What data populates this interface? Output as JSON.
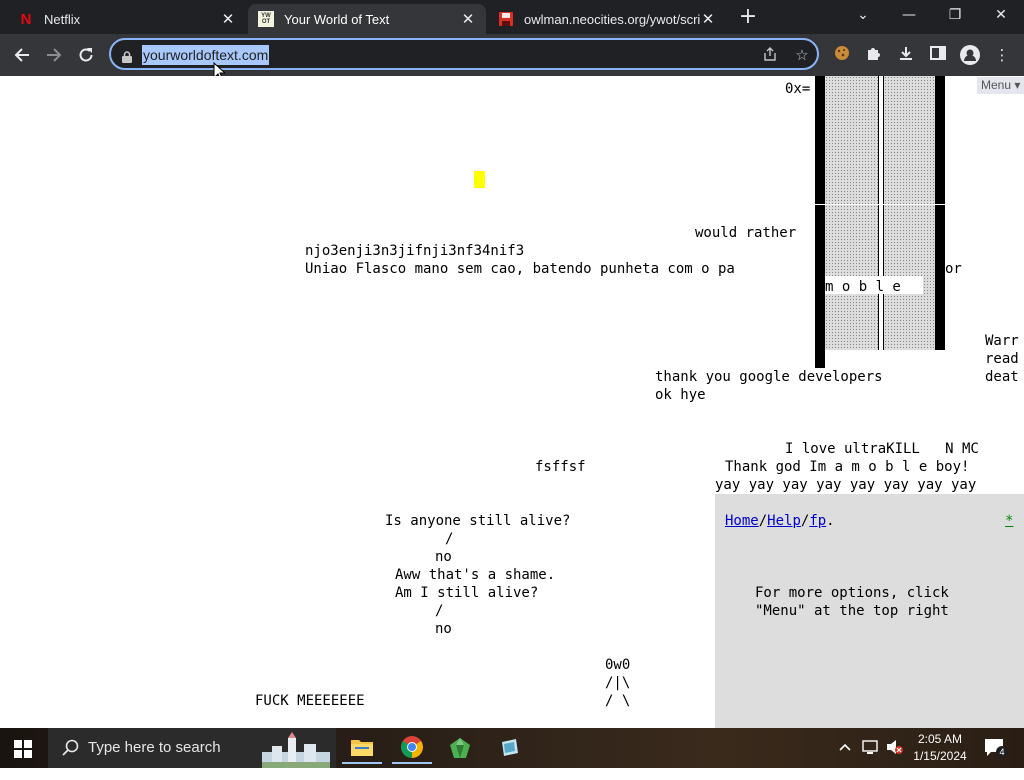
{
  "tabs": [
    {
      "title": "Netflix",
      "favicon": "netflix-n-icon",
      "favicon_color": "#e50914"
    },
    {
      "title": "Your World of Text",
      "favicon": "ywot-favicon-icon",
      "favicon_text": "YW\nOT"
    },
    {
      "title": "owlman.neocities.org/ywot/scrip",
      "favicon": "floppy-disk-icon",
      "favicon_color": "#d93025"
    }
  ],
  "new_tab_label": "+",
  "window_controls": {
    "tab_search": "⌄",
    "minimize": "—",
    "restore": "❐",
    "close": "✕"
  },
  "omnibox": {
    "url": "yourworldoftext.com"
  },
  "page": {
    "menu_label": "Menu ▾",
    "header_coord": "0x=",
    "texts": {
      "would_rather": "would rather",
      "njo": "njo3enji3n3jifnji3nf34nif3",
      "uniao": "Uniao Flasco mano sem cao, batendo punheta com o pa",
      "uniao_tail": "or",
      "moble": "m o b l e",
      "warr": "Warr",
      "read": "read",
      "deat": "deat",
      "thank_google": "thank you google developers",
      "ok_hye": "ok hye",
      "ultrakill": "I love ultraKILL   N MC",
      "fsffsf": "fsffsf",
      "thank_god": "Thank god Im a m o b l e boy!",
      "yay": "yay yay yay yay yay yay yay yay",
      "anyone_alive": "Is anyone still alive?",
      "slash1": "/",
      "no1": "no",
      "aww": "Aww that's a shame.",
      "am_i": "Am I still alive?",
      "slash2": "/",
      "no2": "no",
      "owo": "0w0",
      "owo_arms": "/|\\",
      "owo_legs": "/ \\",
      "fuck": "FUCK MEEEEEEE"
    },
    "panel": {
      "home": "Home",
      "help": "Help",
      "fp": "fp",
      "sep": "/",
      "dot": ".",
      "star": "*",
      "options_line1": "For more options, click",
      "options_line2": "\"Menu\" at the top right"
    }
  },
  "taskbar": {
    "search_placeholder": "Type here to search",
    "time": "2:05 AM",
    "date": "1/15/2024",
    "notification_count": "4"
  }
}
